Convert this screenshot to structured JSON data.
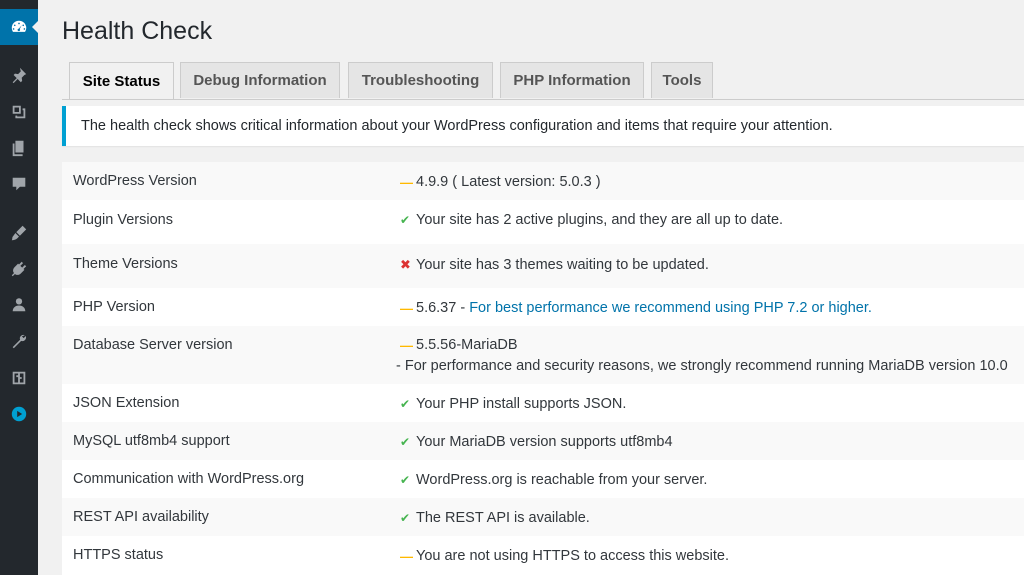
{
  "page": {
    "title": "Health Check",
    "tabs": [
      {
        "label": "Site Status",
        "active": true
      },
      {
        "label": "Debug Information",
        "active": false
      },
      {
        "label": "Troubleshooting",
        "active": false
      },
      {
        "label": "PHP Information",
        "active": false
      },
      {
        "label": "Tools",
        "active": false
      }
    ],
    "notice": "The health check shows critical information about your WordPress configuration and items that require your attention."
  },
  "sidebar": {
    "icons": [
      "dashboard-icon",
      "pin-icon",
      "media-icon",
      "pages-icon",
      "comments-icon",
      "appearance-icon",
      "plugins-icon",
      "users-icon",
      "tools-icon",
      "settings-icon",
      "play-icon"
    ]
  },
  "colors": {
    "accent": "#0073aa",
    "notice_border": "#00a0d2",
    "warning": "#ffb900",
    "success": "#46b450",
    "error": "#dc3232"
  },
  "status_rows": [
    {
      "label": "WordPress Version",
      "status": "warning",
      "text": "4.9.9 ( Latest version: 5.0.3 )"
    },
    {
      "label": "Plugin Versions",
      "status": "good",
      "text": "Your site has 2 active plugins, and they are all up to date."
    },
    {
      "label": "Theme Versions",
      "status": "error",
      "text": "Your site has 3 themes waiting to be updated."
    },
    {
      "label": "PHP Version",
      "status": "warning",
      "text": "5.6.37 - ",
      "link": "For best performance we recommend using PHP 7.2 or higher."
    },
    {
      "label": "Database Server version",
      "status": "warning",
      "text": "5.5.56-MariaDB",
      "detail": "- For performance and security reasons, we strongly recommend running MariaDB version 10.0"
    },
    {
      "label": "JSON Extension",
      "status": "good",
      "text": "Your PHP install supports JSON."
    },
    {
      "label": "MySQL utf8mb4 support",
      "status": "good",
      "text": "Your MariaDB version supports utf8mb4"
    },
    {
      "label": "Communication with WordPress.org",
      "status": "good",
      "text": "WordPress.org is reachable from your server."
    },
    {
      "label": "REST API availability",
      "status": "good",
      "text": "The REST API is available."
    },
    {
      "label": "HTTPS status",
      "status": "warning",
      "text": "You are not using HTTPS to access this website."
    }
  ]
}
